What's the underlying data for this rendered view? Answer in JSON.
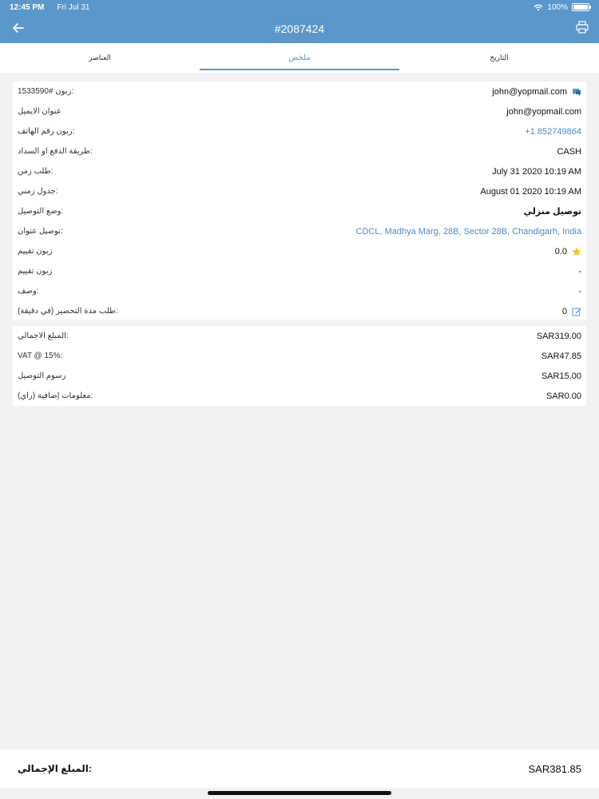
{
  "statusbar": {
    "time": "12:45 PM",
    "date": "Fri Jul 31",
    "battery": "100%"
  },
  "nav": {
    "title": "#2087424",
    "back_icon": "arrow-left-icon",
    "print_icon": "printer-icon"
  },
  "tabs": [
    {
      "label": "العناصر",
      "active": false
    },
    {
      "label": "ملخص",
      "active": true
    },
    {
      "label": "التاريخ",
      "active": false
    }
  ],
  "details": [
    {
      "label": "زبون #1533590:",
      "value": "john@yopmail.com",
      "icon": "chat-icon"
    },
    {
      "label": "عنوان الايميل",
      "value": "john@yopmail.com"
    },
    {
      "label": "زبون رقم الهاتف:",
      "value": "+1 852749864",
      "link": true
    },
    {
      "label": "طريقة الدفع او السداد:",
      "value": "CASH"
    },
    {
      "label": "طلب زمن:",
      "value": "July 31 2020 10:19 AM"
    },
    {
      "label": "جدول زمني:",
      "value": "August 01 2020 10:19 AM"
    },
    {
      "label": "وضع التوصيل:",
      "value": "توصيل منزلي",
      "bold": true
    },
    {
      "label": "توصيل عنوان:",
      "value": "CDCL, Madhya Marg, 28B, Sector 28B, Chandigarh, India",
      "link": true
    },
    {
      "label": "زبون تقييم",
      "value": "0.0",
      "icon": "star-icon"
    },
    {
      "label": "زبون تقييم",
      "value": "-"
    },
    {
      "label": "وصف:",
      "value": "-"
    },
    {
      "label": "طلب مدة التحضير (في دقيقة):",
      "value": "0",
      "icon": "edit-icon"
    }
  ],
  "totals": [
    {
      "label": "المبلغ الاجمالي:",
      "value": "SAR319.00"
    },
    {
      "label": "VAT @ 15%:",
      "value": "SAR47.85"
    },
    {
      "label": "رسوم التوصيل",
      "value": "SAR15.00"
    },
    {
      "label": "معلومات إضافية (راي):",
      "value": "SAR0.00"
    }
  ],
  "footer": {
    "label": "المبلغ الإجمالي:",
    "value": "SAR381.85"
  },
  "colors": {
    "accent": "#5b97cb",
    "link": "#4a8cc6",
    "star": "#f5c518"
  }
}
